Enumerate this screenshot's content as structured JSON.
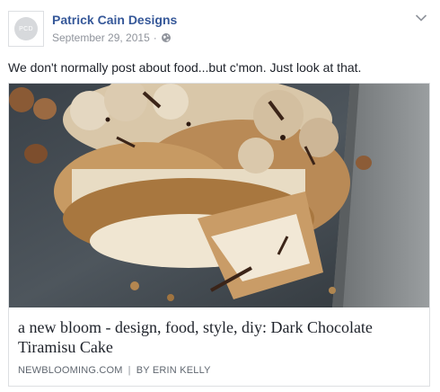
{
  "post": {
    "page_name": "Patrick Cain Designs",
    "avatar_initials": "PCD",
    "date": "September 29, 2015",
    "separator": "·",
    "audience_icon": "globe-icon",
    "menu_icon": "chevron-down-icon",
    "text": "We don't normally post about food...but c'mon. Just look at that."
  },
  "link_preview": {
    "image_description_icon": "photo",
    "title": "a new bloom - design, food, style, diy: Dark Chocolate Tiramisu Cake",
    "domain": "NEWBLOOMING.COM",
    "separator": "|",
    "author": "BY ERIN KELLY"
  },
  "colors": {
    "link_blue": "#365899",
    "meta_gray": "#90949c",
    "border": "#dddfe2",
    "text": "#1d2129"
  }
}
